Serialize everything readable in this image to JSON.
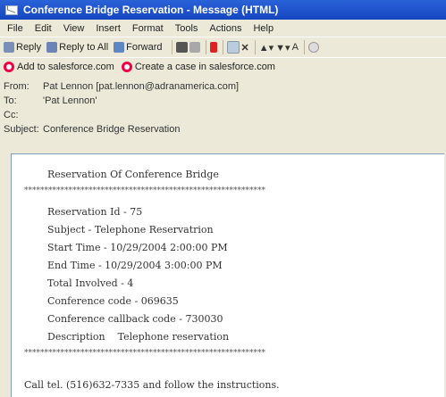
{
  "window": {
    "title": "Conference Bridge Reservation - Message (HTML)"
  },
  "menu": [
    "File",
    "Edit",
    "View",
    "Insert",
    "Format",
    "Tools",
    "Actions",
    "Help"
  ],
  "toolbar": {
    "reply": "Reply",
    "reply_all": "Reply to All",
    "forward": "Forward"
  },
  "salesforce": {
    "add": "Add to salesforce.com",
    "case": "Create a case in salesforce.com"
  },
  "header": {
    "from_label": "From:",
    "from_value": "Pat Lennon [pat.lennon@adranamerica.com]",
    "to_label": "To:",
    "to_value": "'Pat Lennon'",
    "cc_label": "Cc:",
    "cc_value": "",
    "subject_label": "Subject:",
    "subject_value": "Conference Bridge Reservation"
  },
  "message": {
    "title": "Reservation Of Conference Bridge",
    "separator": "************************************************************",
    "lines": [
      "Reservation Id - 75",
      "Subject - Telephone Reservatrion",
      "Start Time - 10/29/2004 2:00:00 PM",
      "End Time - 10/29/2004 3:00:00 PM",
      "Total Involved - 4",
      "Conference code - 069635",
      "Conference callback code - 730030",
      "Description    Telephone reservation"
    ],
    "footer": "Call tel. (516)632-7335 and follow the instructions."
  }
}
